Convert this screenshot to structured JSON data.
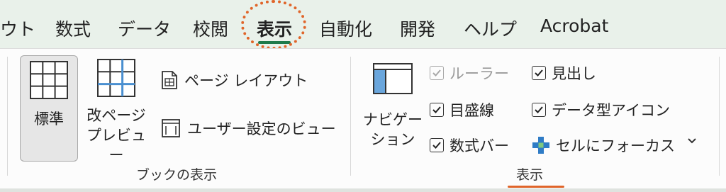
{
  "tabs": [
    {
      "label": "ウト"
    },
    {
      "label": "数式"
    },
    {
      "label": "データ"
    },
    {
      "label": "校閲"
    },
    {
      "label": "表示"
    },
    {
      "label": "自動化"
    },
    {
      "label": "開発"
    },
    {
      "label": "ヘルプ"
    },
    {
      "label": "Acrobat"
    }
  ],
  "active_tab": "表示",
  "book_view": {
    "group_label": "ブックの表示",
    "normal": "標準",
    "page_break_line1": "改ページ",
    "page_break_line2": "プレビュー",
    "page_layout": "ページ レイアウト",
    "custom_views": "ユーザー設定のビュー"
  },
  "show": {
    "group_label": "表示",
    "navigation_line1": "ナビゲー",
    "navigation_line2": "ション",
    "ruler": "ルーラー",
    "ruler_checked": true,
    "ruler_disabled": true,
    "gridlines": "目盛線",
    "gridlines_checked": true,
    "formula_bar": "数式バー",
    "formula_bar_checked": true,
    "headings": "見出し",
    "headings_checked": true,
    "data_type_icons": "データ型アイコン",
    "data_type_icons_checked": true,
    "focus_cell": "セルにフォーカス"
  },
  "colors": {
    "accent_green": "#1d7a4b",
    "highlight_orange": "#e0652a",
    "nav_pane_blue": "#6aa6dc"
  }
}
